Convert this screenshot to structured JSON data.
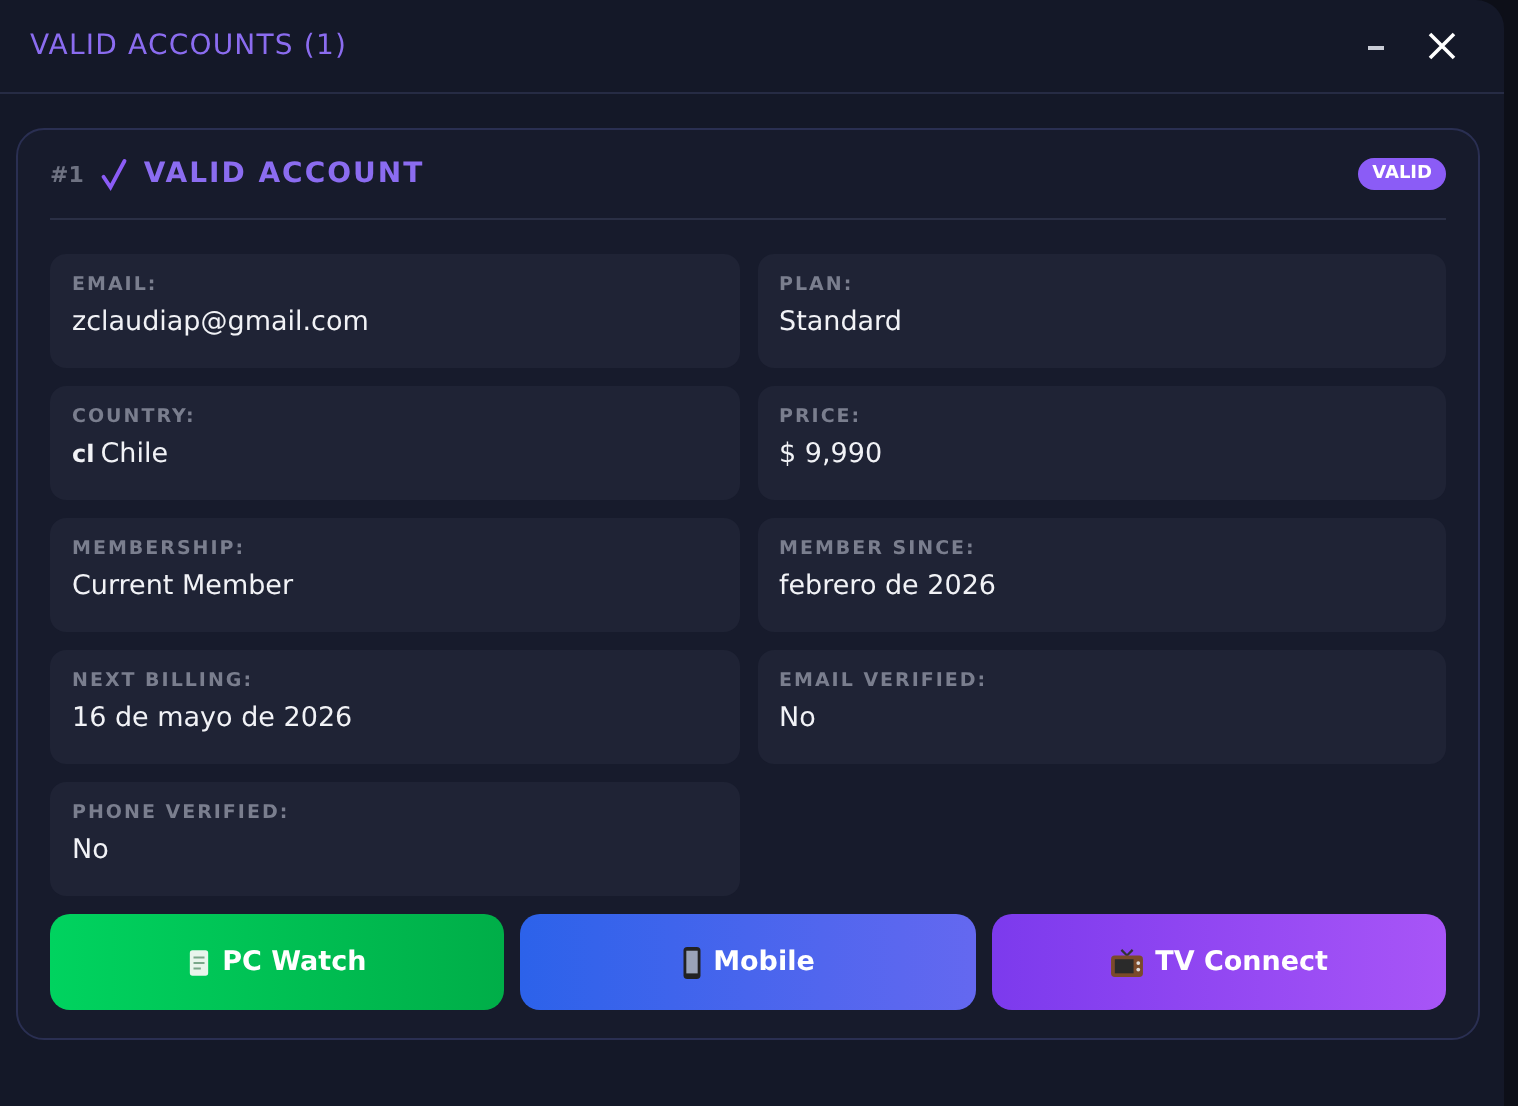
{
  "window": {
    "title": "VALID ACCOUNTS (1)",
    "controls": [
      {
        "kind": "minimize"
      },
      {
        "kind": "close"
      }
    ]
  },
  "account": {
    "index": "#1",
    "title": "VALID ACCOUNT",
    "badge": "VALID",
    "fields": [
      {
        "label": "EMAIL:",
        "value": "zclaudiap@gmail.com"
      },
      {
        "label": "PLAN:",
        "value": "Standard"
      },
      {
        "label": "COUNTRY:",
        "prefix": "cl",
        "value": "Chile"
      },
      {
        "label": "PRICE:",
        "value": "$ 9,990"
      },
      {
        "label": "MEMBERSHIP:",
        "value": "Current Member"
      },
      {
        "label": "MEMBER SINCE:",
        "value": "febrero de 2026"
      },
      {
        "label": "NEXT BILLING:",
        "value": "16 de mayo de 2026"
      },
      {
        "label": "EMAIL VERIFIED:",
        "value": "No"
      },
      {
        "label": "PHONE VERIFIED:",
        "value": "No"
      }
    ],
    "buttons": [
      {
        "kind": "pc",
        "label": "PC Watch"
      },
      {
        "kind": "mobile",
        "label": "Mobile"
      },
      {
        "kind": "tv",
        "label": "TV Connect"
      }
    ]
  }
}
